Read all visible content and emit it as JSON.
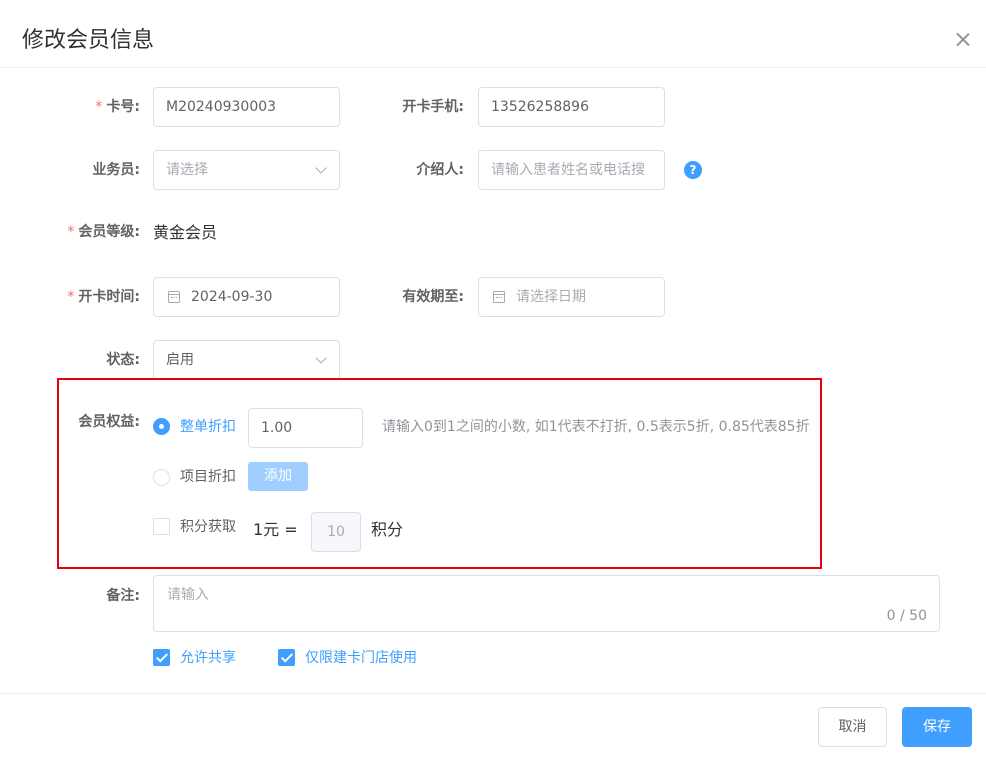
{
  "dialog": {
    "title": "修改会员信息"
  },
  "form": {
    "card_no": {
      "label": "卡号:",
      "value": "M20240930003",
      "required": true
    },
    "phone": {
      "label": "开卡手机:",
      "value": "13526258896"
    },
    "salesperson": {
      "label": "业务员:",
      "placeholder": "请选择"
    },
    "referrer": {
      "label": "介绍人:",
      "placeholder": "请输入患者姓名或电话搜",
      "help_icon": "?"
    },
    "level": {
      "label": "会员等级:",
      "value": "黄金会员",
      "required": true
    },
    "open_date": {
      "label": "开卡时间:",
      "value": "2024-09-30",
      "required": true
    },
    "valid_until": {
      "label": "有效期至:",
      "placeholder": "请选择日期"
    },
    "status": {
      "label": "状态:",
      "value": "启用"
    },
    "benefits": {
      "label": "会员权益:",
      "whole_discount": {
        "label": "整单折扣",
        "selected": true,
        "value": "1.00",
        "hint": "请输入0到1之间的小数, 如1代表不打折, 0.5表示5折, 0.85代表85折"
      },
      "item_discount": {
        "label": "项目折扣",
        "selected": false,
        "add_button": "添加"
      },
      "points": {
        "label": "积分获取",
        "checked": false,
        "prefix": "1元 =",
        "value": "10",
        "suffix": "积分"
      }
    },
    "remark": {
      "label": "备注:",
      "placeholder": "请输入",
      "counter": "0 / 50"
    },
    "allow_share": {
      "label": "允许共享",
      "checked": true
    },
    "store_only": {
      "label": "仅限建卡门店使用",
      "checked": true
    }
  },
  "footer": {
    "cancel_label": "取消",
    "save_label": "保存"
  },
  "colors": {
    "primary": "#409eff",
    "highlight_box": "#e60012",
    "required": "#f56c6c"
  }
}
